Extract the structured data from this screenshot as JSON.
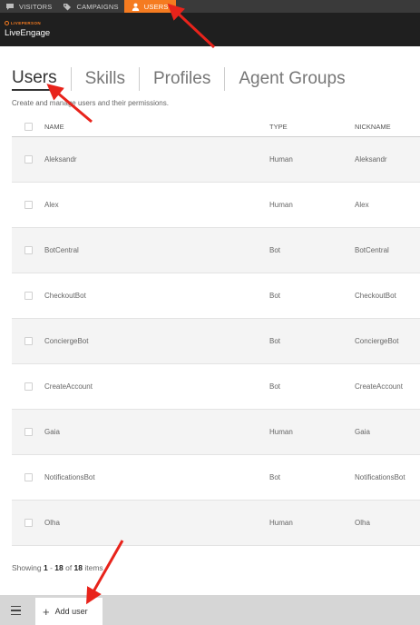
{
  "topnav": {
    "items": [
      {
        "label": "VISITORS",
        "icon": "chat-bubble-icon"
      },
      {
        "label": "CAMPAIGNS",
        "icon": "tag-icon"
      },
      {
        "label": "USERS",
        "icon": "user-icon",
        "active": true
      }
    ]
  },
  "brand": {
    "small": "LIVEPERSON",
    "name": "LiveEngage"
  },
  "tabs": [
    {
      "label": "Users",
      "active": true
    },
    {
      "label": "Skills"
    },
    {
      "label": "Profiles"
    },
    {
      "label": "Agent Groups"
    }
  ],
  "subtitle": "Create and manage users and their permissions.",
  "table": {
    "headers": {
      "name": "NAME",
      "type": "TYPE",
      "nickname": "NICKNAME"
    },
    "rows": [
      {
        "name": "Aleksandr",
        "type": "Human",
        "nickname": "Aleksandr"
      },
      {
        "name": "Alex",
        "type": "Human",
        "nickname": "Alex"
      },
      {
        "name": "BotCentral",
        "type": "Bot",
        "nickname": "BotCentral"
      },
      {
        "name": "CheckoutBot",
        "type": "Bot",
        "nickname": "CheckoutBot"
      },
      {
        "name": "ConciergeBot",
        "type": "Bot",
        "nickname": "ConciergeBot"
      },
      {
        "name": "CreateAccount",
        "type": "Bot",
        "nickname": "CreateAccount"
      },
      {
        "name": "Gaia",
        "type": "Human",
        "nickname": "Gaia"
      },
      {
        "name": "NotificationsBot",
        "type": "Bot",
        "nickname": "NotificationsBot"
      },
      {
        "name": "Olha",
        "type": "Human",
        "nickname": "Olha"
      }
    ]
  },
  "pagination": {
    "prefix": "Showing ",
    "from": "1",
    "dash": " - ",
    "to": "18",
    "of": " of ",
    "total": "18",
    "suffix": " items"
  },
  "bottombar": {
    "add_label": "Add user"
  },
  "colors": {
    "accent": "#f57b20",
    "annotation": "#e8231b"
  }
}
